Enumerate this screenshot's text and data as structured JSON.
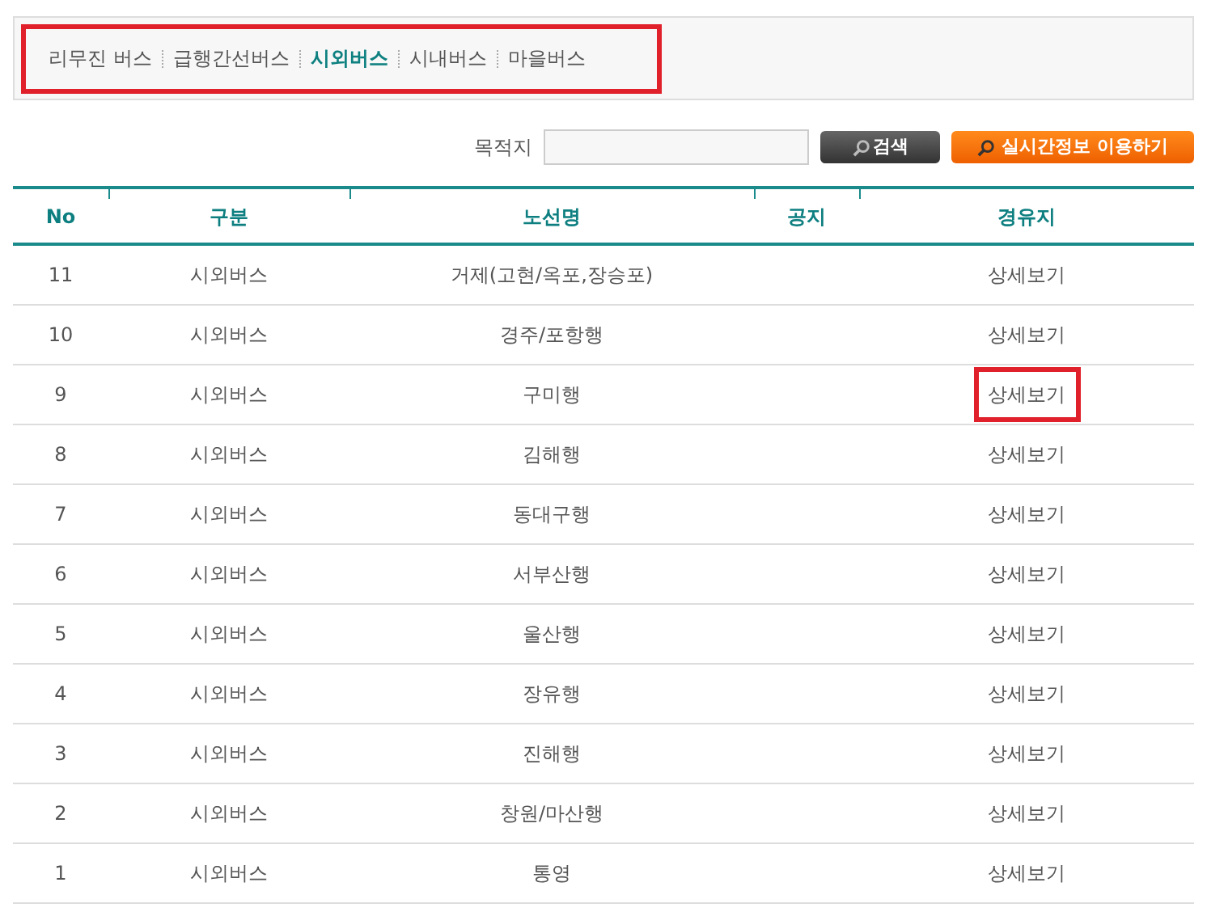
{
  "tabs_highlighted": true,
  "tabs": [
    {
      "label": "리무진 버스",
      "selected": false
    },
    {
      "label": "급행간선버스",
      "selected": false
    },
    {
      "label": "시외버스",
      "selected": true
    },
    {
      "label": "시내버스",
      "selected": false
    },
    {
      "label": "마을버스",
      "selected": false
    }
  ],
  "search": {
    "label": "목적지",
    "button": "검색",
    "realtime_button": "실시간정보 이용하기"
  },
  "table": {
    "columns": [
      "No",
      "구분",
      "노선명",
      "공지",
      "경유지"
    ],
    "rows": [
      {
        "no": "11",
        "type": "시외버스",
        "route": "거제(고현/옥포,장승포)",
        "link": "상세보기",
        "highlighted": false
      },
      {
        "no": "10",
        "type": "시외버스",
        "route": "경주/포항행",
        "link": "상세보기",
        "highlighted": false
      },
      {
        "no": "9",
        "type": "시외버스",
        "route": "구미행",
        "link": "상세보기",
        "highlighted": true
      },
      {
        "no": "8",
        "type": "시외버스",
        "route": "김해행",
        "link": "상세보기",
        "highlighted": false
      },
      {
        "no": "7",
        "type": "시외버스",
        "route": "동대구행",
        "link": "상세보기",
        "highlighted": false
      },
      {
        "no": "6",
        "type": "시외버스",
        "route": "서부산행",
        "link": "상세보기",
        "highlighted": false
      },
      {
        "no": "5",
        "type": "시외버스",
        "route": "울산행",
        "link": "상세보기",
        "highlighted": false
      },
      {
        "no": "4",
        "type": "시외버스",
        "route": "장유행",
        "link": "상세보기",
        "highlighted": false
      },
      {
        "no": "3",
        "type": "시외버스",
        "route": "진해행",
        "link": "상세보기",
        "highlighted": false
      },
      {
        "no": "2",
        "type": "시외버스",
        "route": "창원/마산행",
        "link": "상세보기",
        "highlighted": false
      },
      {
        "no": "1",
        "type": "시외버스",
        "route": "통영",
        "link": "상세보기",
        "highlighted": false
      }
    ]
  }
}
